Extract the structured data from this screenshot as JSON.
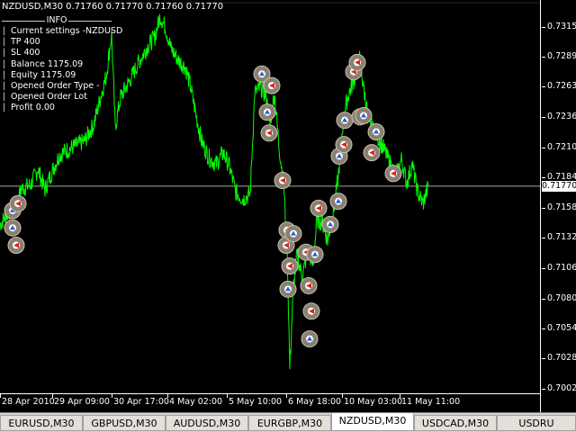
{
  "window": {
    "title": "NZDUSD,M30  0.71760 0.71770 0.71760 0.71770"
  },
  "info_panel": {
    "header": "INFO",
    "lines": [
      "Current settings -NZDUSD",
      "TP 400",
      "SL 400",
      "Balance 1175.09",
      "Equity 1175.09",
      "Opened Order Type -",
      "Opened Order Lot",
      "Profit 0.00"
    ]
  },
  "price_axis": {
    "ticks": [
      "0.73150",
      "0.72890",
      "0.72630",
      "0.72365",
      "0.72105",
      "0.71845",
      "0.71585",
      "0.71325",
      "0.71060",
      "0.70800",
      "0.70540",
      "0.70280",
      "0.70020"
    ],
    "current_price": "0.71770"
  },
  "time_axis": {
    "labels": [
      "28 Apr 2010",
      "29 Apr 09:00",
      "30 Apr 17:00",
      "4 May 02:00",
      "5 May 10:00",
      "6 May 18:00",
      "10 May 03:00",
      "11 May 11:00"
    ]
  },
  "tabs": [
    {
      "label": "EURUSD,M30",
      "active": false
    },
    {
      "label": "GBPUSD,M30",
      "active": false
    },
    {
      "label": "AUDUSD,M30",
      "active": false
    },
    {
      "label": "EURGBP,M30",
      "active": false
    },
    {
      "label": "NZDUSD,M30",
      "active": true
    },
    {
      "label": "USDCAD,M30",
      "active": false
    },
    {
      "label": "USDRU",
      "active": false
    }
  ],
  "chart_data": {
    "type": "line",
    "title": "NZDUSD,M30  0.71760 0.71770 0.71760 0.71770",
    "series": [
      {
        "name": "NZDUSD,M30",
        "color": "#00ff00",
        "x": [
          "28 Apr 2010",
          "29 Apr 09:00",
          "30 Apr 17:00",
          "4 May 02:00",
          "5 May 10:00",
          "6 May 18:00",
          "10 May 03:00",
          "11 May 11:00"
        ],
        "points": [
          {
            "t": 0,
            "v": 0.7144
          },
          {
            "t": 10,
            "v": 0.7155
          },
          {
            "t": 18,
            "v": 0.716
          },
          {
            "t": 24,
            "v": 0.7175
          },
          {
            "t": 34,
            "v": 0.7178
          },
          {
            "t": 42,
            "v": 0.7192
          },
          {
            "t": 50,
            "v": 0.7174
          },
          {
            "t": 58,
            "v": 0.719
          },
          {
            "t": 66,
            "v": 0.7204
          },
          {
            "t": 74,
            "v": 0.7208
          },
          {
            "t": 84,
            "v": 0.7212
          },
          {
            "t": 94,
            "v": 0.7216
          },
          {
            "t": 104,
            "v": 0.723
          },
          {
            "t": 112,
            "v": 0.7255
          },
          {
            "t": 118,
            "v": 0.7272
          },
          {
            "t": 124,
            "v": 0.7308
          },
          {
            "t": 128,
            "v": 0.7228
          },
          {
            "t": 134,
            "v": 0.7254
          },
          {
            "t": 144,
            "v": 0.7268
          },
          {
            "t": 154,
            "v": 0.7284
          },
          {
            "t": 164,
            "v": 0.7298
          },
          {
            "t": 172,
            "v": 0.7306
          },
          {
            "t": 178,
            "v": 0.7324
          },
          {
            "t": 184,
            "v": 0.7314
          },
          {
            "t": 190,
            "v": 0.7296
          },
          {
            "t": 198,
            "v": 0.7286
          },
          {
            "t": 206,
            "v": 0.728
          },
          {
            "t": 212,
            "v": 0.7262
          },
          {
            "t": 218,
            "v": 0.7238
          },
          {
            "t": 224,
            "v": 0.7216
          },
          {
            "t": 232,
            "v": 0.7202
          },
          {
            "t": 240,
            "v": 0.7196
          },
          {
            "t": 248,
            "v": 0.7206
          },
          {
            "t": 255,
            "v": 0.7194
          },
          {
            "t": 262,
            "v": 0.7172
          },
          {
            "t": 270,
            "v": 0.7166
          },
          {
            "t": 278,
            "v": 0.717
          },
          {
            "t": 283,
            "v": 0.7258
          },
          {
            "t": 290,
            "v": 0.7262
          },
          {
            "t": 296,
            "v": 0.7254
          },
          {
            "t": 300,
            "v": 0.723
          },
          {
            "t": 305,
            "v": 0.7258
          },
          {
            "t": 310,
            "v": 0.7212
          },
          {
            "t": 315,
            "v": 0.718
          },
          {
            "t": 319,
            "v": 0.7125
          },
          {
            "t": 322,
            "v": 0.702
          },
          {
            "t": 326,
            "v": 0.709
          },
          {
            "t": 330,
            "v": 0.7118
          },
          {
            "t": 336,
            "v": 0.7098
          },
          {
            "t": 342,
            "v": 0.7122
          },
          {
            "t": 348,
            "v": 0.7108
          },
          {
            "t": 352,
            "v": 0.7148
          },
          {
            "t": 358,
            "v": 0.7146
          },
          {
            "t": 364,
            "v": 0.713
          },
          {
            "t": 370,
            "v": 0.7152
          },
          {
            "t": 376,
            "v": 0.7186
          },
          {
            "t": 382,
            "v": 0.724
          },
          {
            "t": 388,
            "v": 0.7258
          },
          {
            "t": 394,
            "v": 0.727
          },
          {
            "t": 399,
            "v": 0.729
          },
          {
            "t": 404,
            "v": 0.7262
          },
          {
            "t": 410,
            "v": 0.7232
          },
          {
            "t": 418,
            "v": 0.7222
          },
          {
            "t": 426,
            "v": 0.721
          },
          {
            "t": 434,
            "v": 0.7196
          },
          {
            "t": 440,
            "v": 0.7186
          },
          {
            "t": 446,
            "v": 0.72
          },
          {
            "t": 452,
            "v": 0.718
          },
          {
            "t": 458,
            "v": 0.7196
          },
          {
            "t": 464,
            "v": 0.7172
          },
          {
            "t": 470,
            "v": 0.7162
          },
          {
            "t": 476,
            "v": 0.7177
          }
        ]
      }
    ],
    "current_price_line": 0.7177,
    "ylim": [
      0.6998,
      0.7338
    ],
    "xlim": [
      0,
      600
    ],
    "grid": false,
    "legend": "none",
    "order_markers": [
      {
        "t": 14,
        "v": 0.7156,
        "dir": "buy"
      },
      {
        "t": 14,
        "v": 0.7141,
        "dir": "buy"
      },
      {
        "t": 18,
        "v": 0.7126,
        "dir": "sell"
      },
      {
        "t": 20,
        "v": 0.7162,
        "dir": "sell"
      },
      {
        "t": 291,
        "v": 0.7274,
        "dir": "buy"
      },
      {
        "t": 297,
        "v": 0.7241,
        "dir": "buy"
      },
      {
        "t": 299,
        "v": 0.7223,
        "dir": "sell"
      },
      {
        "t": 302,
        "v": 0.7264,
        "dir": "sell"
      },
      {
        "t": 314,
        "v": 0.7182,
        "dir": "sell"
      },
      {
        "t": 319,
        "v": 0.7139,
        "dir": "sell"
      },
      {
        "t": 318,
        "v": 0.7126,
        "dir": "sell"
      },
      {
        "t": 322,
        "v": 0.7108,
        "dir": "sell"
      },
      {
        "t": 320,
        "v": 0.7088,
        "dir": "buy"
      },
      {
        "t": 326,
        "v": 0.7136,
        "dir": "buy"
      },
      {
        "t": 340,
        "v": 0.712,
        "dir": "sell"
      },
      {
        "t": 343,
        "v": 0.7091,
        "dir": "sell"
      },
      {
        "t": 346,
        "v": 0.7069,
        "dir": "sell"
      },
      {
        "t": 344,
        "v": 0.7045,
        "dir": "buy"
      },
      {
        "t": 350,
        "v": 0.7118,
        "dir": "buy"
      },
      {
        "t": 354,
        "v": 0.7158,
        "dir": "sell"
      },
      {
        "t": 367,
        "v": 0.7144,
        "dir": "buy"
      },
      {
        "t": 376,
        "v": 0.7164,
        "dir": "buy"
      },
      {
        "t": 377,
        "v": 0.7203,
        "dir": "buy"
      },
      {
        "t": 382,
        "v": 0.7213,
        "dir": "sell"
      },
      {
        "t": 383,
        "v": 0.7234,
        "dir": "buy"
      },
      {
        "t": 393,
        "v": 0.7276,
        "dir": "sell"
      },
      {
        "t": 397,
        "v": 0.7284,
        "dir": "sell"
      },
      {
        "t": 400,
        "v": 0.7237,
        "dir": "sell"
      },
      {
        "t": 404,
        "v": 0.7238,
        "dir": "buy"
      },
      {
        "t": 413,
        "v": 0.7206,
        "dir": "sell"
      },
      {
        "t": 418,
        "v": 0.7224,
        "dir": "buy"
      },
      {
        "t": 437,
        "v": 0.7188,
        "dir": "sell"
      }
    ]
  }
}
